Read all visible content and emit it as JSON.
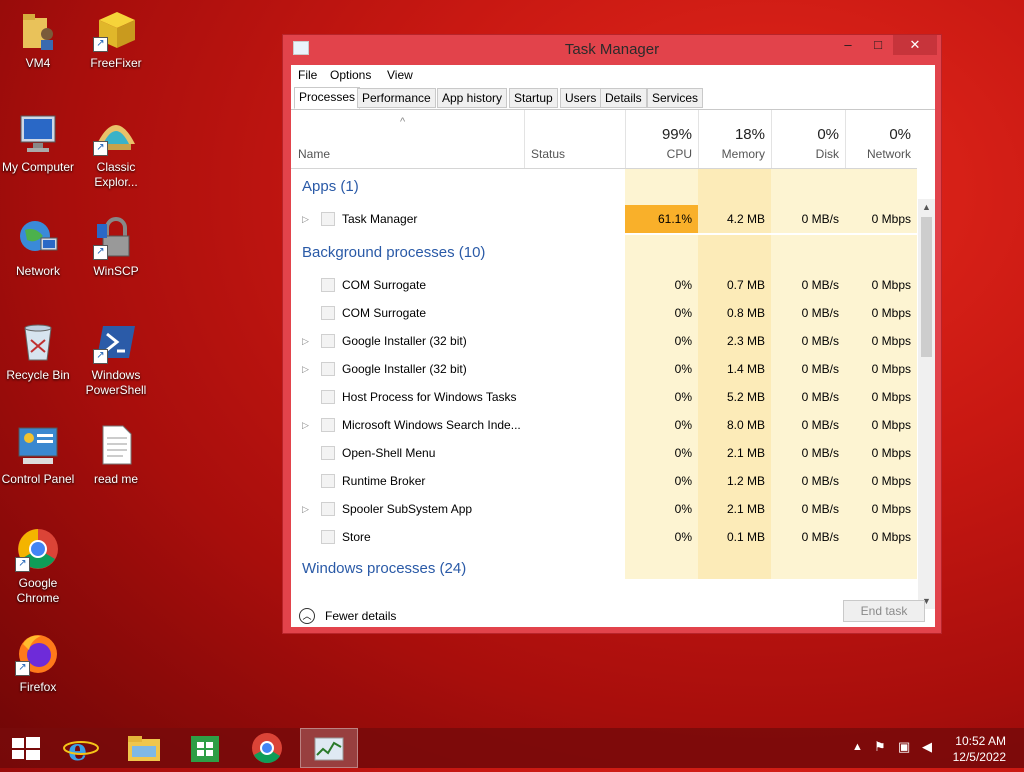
{
  "desktop": {
    "icons": [
      {
        "label": "VM4",
        "name": "folder-user-icon"
      },
      {
        "label": "FreeFixer",
        "name": "freefixer-icon"
      },
      {
        "label": "My Computer",
        "name": "computer-icon"
      },
      {
        "label": "Classic Explor...",
        "name": "shell-icon"
      },
      {
        "label": "Network",
        "name": "network-icon"
      },
      {
        "label": "WinSCP",
        "name": "lock-icon"
      },
      {
        "label": "Recycle Bin",
        "name": "recycle-bin-icon"
      },
      {
        "label": "Windows PowerShell",
        "name": "powershell-icon"
      },
      {
        "label": "Control Panel",
        "name": "control-panel-icon"
      },
      {
        "label": "read me",
        "name": "text-file-icon"
      },
      {
        "label": "Google Chrome",
        "name": "chrome-icon"
      },
      {
        "label": "Firefox",
        "name": "firefox-icon"
      }
    ]
  },
  "window": {
    "title": "Task Manager",
    "min_glyph": "–",
    "max_glyph": "□",
    "close_glyph": "✕",
    "menu": [
      "File",
      "Options",
      "View"
    ],
    "tabs": [
      "Processes",
      "Performance",
      "App history",
      "Startup",
      "Users",
      "Details",
      "Services"
    ],
    "active_tab": "Processes"
  },
  "columns": {
    "name": "Name",
    "status": "Status",
    "cpu": {
      "pct": "99%",
      "label": "CPU"
    },
    "memory": {
      "pct": "18%",
      "label": "Memory"
    },
    "disk": {
      "pct": "0%",
      "label": "Disk"
    },
    "network": {
      "pct": "0%",
      "label": "Network"
    },
    "sort_glyph": "^"
  },
  "groups": {
    "apps": "Apps (1)",
    "background": "Background processes (10)",
    "windows": "Windows processes (24)"
  },
  "apps": [
    {
      "name": "Task Manager",
      "expand": "▷",
      "cpu": "61.1%",
      "mem": "4.2 MB",
      "disk": "0 MB/s",
      "net": "0 Mbps"
    }
  ],
  "background": [
    {
      "name": "COM Surrogate",
      "expand": "",
      "cpu": "0%",
      "mem": "0.7 MB",
      "disk": "0 MB/s",
      "net": "0 Mbps"
    },
    {
      "name": "COM Surrogate",
      "expand": "",
      "cpu": "0%",
      "mem": "0.8 MB",
      "disk": "0 MB/s",
      "net": "0 Mbps"
    },
    {
      "name": "Google Installer (32 bit)",
      "expand": "▷",
      "cpu": "0%",
      "mem": "2.3 MB",
      "disk": "0 MB/s",
      "net": "0 Mbps"
    },
    {
      "name": "Google Installer (32 bit)",
      "expand": "▷",
      "cpu": "0%",
      "mem": "1.4 MB",
      "disk": "0 MB/s",
      "net": "0 Mbps"
    },
    {
      "name": "Host Process for Windows Tasks",
      "expand": "",
      "cpu": "0%",
      "mem": "5.2 MB",
      "disk": "0 MB/s",
      "net": "0 Mbps"
    },
    {
      "name": "Microsoft Windows Search Inde...",
      "expand": "▷",
      "cpu": "0%",
      "mem": "8.0 MB",
      "disk": "0 MB/s",
      "net": "0 Mbps"
    },
    {
      "name": "Open-Shell Menu",
      "expand": "",
      "cpu": "0%",
      "mem": "2.1 MB",
      "disk": "0 MB/s",
      "net": "0 Mbps"
    },
    {
      "name": "Runtime Broker",
      "expand": "",
      "cpu": "0%",
      "mem": "1.2 MB",
      "disk": "0 MB/s",
      "net": "0 Mbps"
    },
    {
      "name": "Spooler SubSystem App",
      "expand": "▷",
      "cpu": "0%",
      "mem": "2.1 MB",
      "disk": "0 MB/s",
      "net": "0 Mbps"
    },
    {
      "name": "Store",
      "expand": "",
      "cpu": "0%",
      "mem": "0.1 MB",
      "disk": "0 MB/s",
      "net": "0 Mbps"
    }
  ],
  "footer": {
    "fewer_details": "Fewer details",
    "end_task": "End task"
  },
  "taskbar": {
    "items": [
      "start-icon",
      "internet-explorer-icon",
      "file-explorer-icon",
      "store-icon",
      "chrome-icon",
      "task-manager-icon"
    ],
    "time": "10:52 AM",
    "date": "12/5/2022"
  },
  "colors": {
    "desktop_red": "#c81812",
    "window_frame": "#e2434b",
    "cpu_hot": "#f9b02a",
    "heat_light": "#fdf4d2",
    "heat_mem": "#fcebb8",
    "group_blue": "#2a5aa7"
  }
}
